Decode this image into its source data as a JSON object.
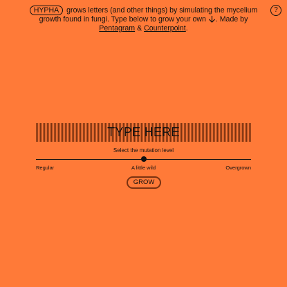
{
  "intro": {
    "brand": "HYPHA",
    "text_1": " grows letters (and other things) by simulating the mycelium growth found in fungi. Type below to grow your own",
    "text_2": ". Made by ",
    "link_1": "Pentagram",
    "amp": " & ",
    "link_2": "Counterpoint",
    "end": "."
  },
  "help": {
    "label": "?"
  },
  "input": {
    "text": "TYPE HERE"
  },
  "mutation": {
    "label": "Select the mutation level",
    "options": [
      "Regular",
      "A little wild",
      "Overgrown"
    ],
    "selected": "A little wild",
    "level": 0.5
  },
  "grow_button": {
    "label": "GROW"
  },
  "colors": {
    "background": "#ff7a38",
    "ink": "#111111",
    "accent_dark": "#7a3210"
  }
}
